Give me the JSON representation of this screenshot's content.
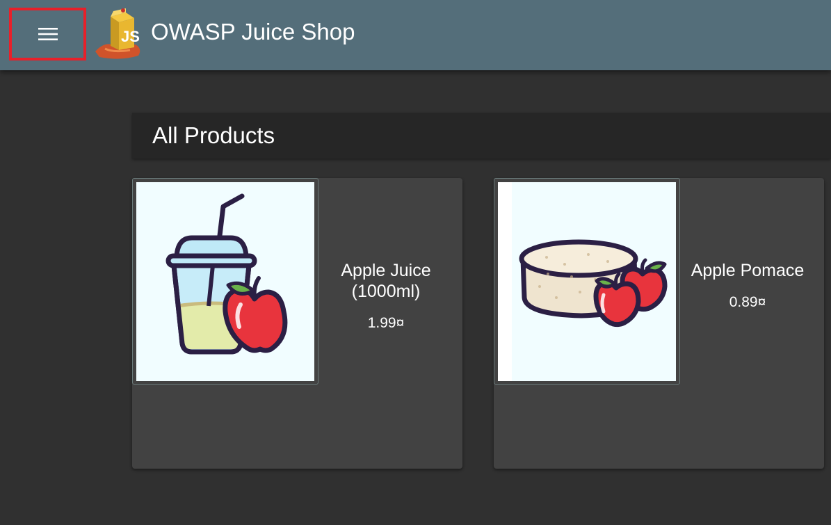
{
  "header": {
    "title": "OWASP Juice Shop",
    "menu_icon": "hamburger-menu-icon",
    "logo_icon": "juice-carton-logo-icon",
    "logo_text": "JS",
    "highlight_color": "#e8202a",
    "toolbar_color": "#546e7a"
  },
  "main": {
    "heading": "All Products",
    "products": [
      {
        "name": "Apple Juice (1000ml)",
        "price": "1.99¤",
        "image_icon": "apple-juice-cup-icon"
      },
      {
        "name": "Apple Pomace",
        "price": "0.89¤",
        "image_icon": "apple-pomace-icon"
      }
    ]
  }
}
